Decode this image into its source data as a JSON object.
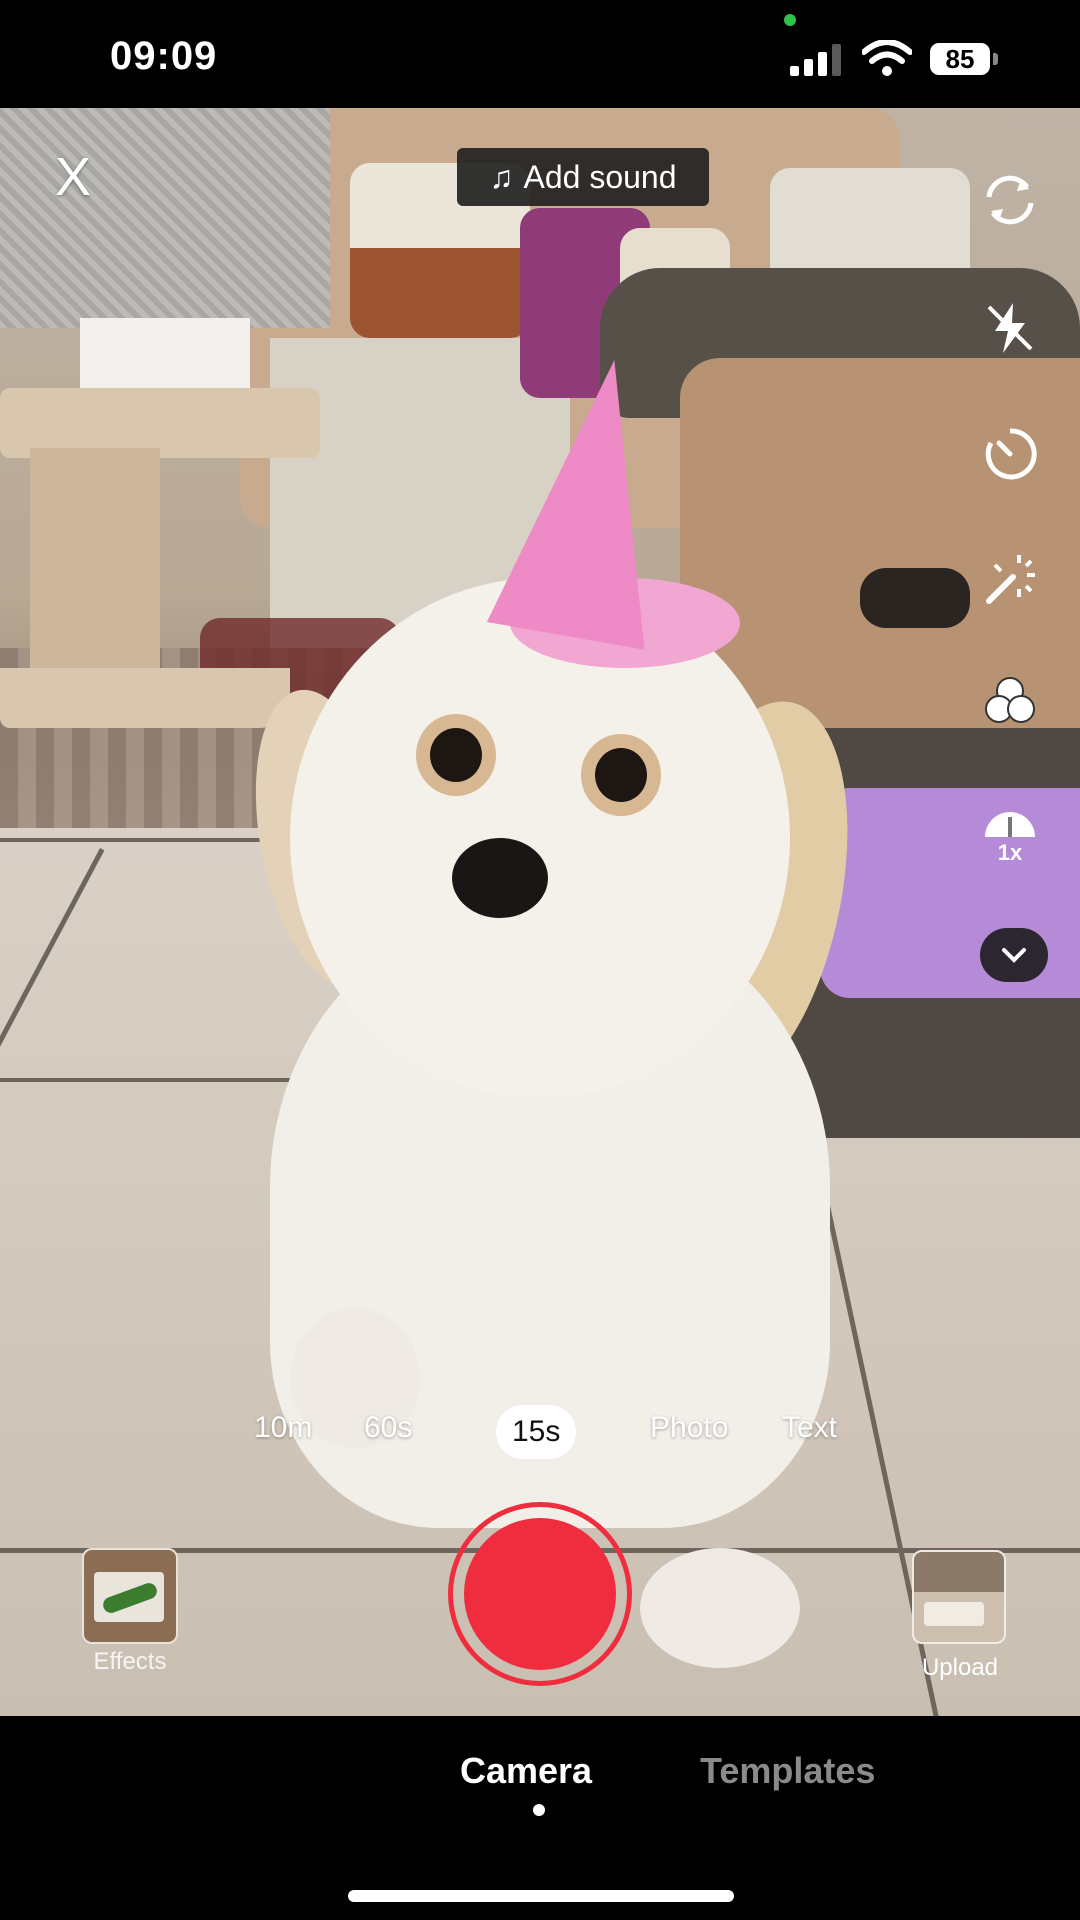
{
  "status_bar": {
    "time": "09:09",
    "battery": "85",
    "icons": [
      "signal-icon",
      "wifi-icon",
      "battery-icon"
    ]
  },
  "top_bar": {
    "close_label": "X",
    "add_sound_label": "Add sound",
    "add_sound_icon": "music-note-icon"
  },
  "right_tools": {
    "icons": [
      "flip-camera-icon",
      "flash-off-icon",
      "timer-icon",
      "beauty-wand-icon",
      "filters-icon",
      "speed-icon",
      "chevron-down-icon"
    ],
    "speed_label": "1x"
  },
  "modes": {
    "items": [
      "10m",
      "60s",
      "15s",
      "Photo",
      "Text"
    ],
    "selected": "15s"
  },
  "record_row": {
    "effects_label": "Effects",
    "upload_label": "Upload"
  },
  "bottom_tabs": {
    "camera": "Camera",
    "templates": "Templates",
    "selected": "Camera"
  },
  "colors": {
    "record": "#ef2d3e",
    "background": "#000000",
    "inactive_tab": "#8a8a8a"
  }
}
